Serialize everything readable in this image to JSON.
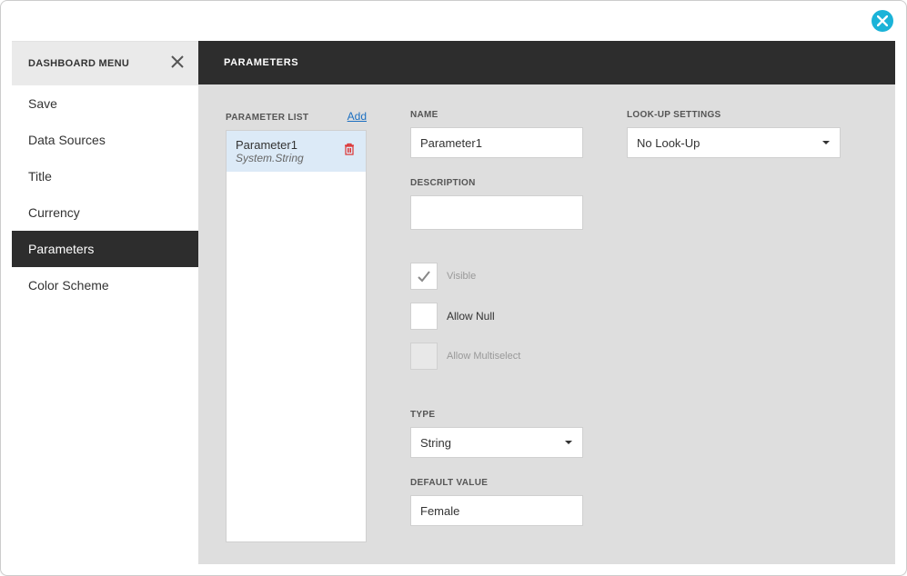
{
  "sidebar": {
    "title": "DASHBOARD MENU",
    "items": [
      {
        "label": "Save",
        "active": false
      },
      {
        "label": "Data Sources",
        "active": false
      },
      {
        "label": "Title",
        "active": false
      },
      {
        "label": "Currency",
        "active": false
      },
      {
        "label": "Parameters",
        "active": true
      },
      {
        "label": "Color Scheme",
        "active": false
      }
    ]
  },
  "header": {
    "title": "PARAMETERS"
  },
  "paramList": {
    "label": "PARAMETER LIST",
    "addLabel": "Add",
    "items": [
      {
        "name": "Parameter1",
        "type": "System.String"
      }
    ]
  },
  "form": {
    "nameLabel": "NAME",
    "nameValue": "Parameter1",
    "descLabel": "DESCRIPTION",
    "descValue": "",
    "visibleLabel": "Visible",
    "allowNullLabel": "Allow Null",
    "allowMultiLabel": "Allow Multiselect",
    "typeLabel": "TYPE",
    "typeValue": "String",
    "defaultLabel": "DEFAULT VALUE",
    "defaultValue": "Female"
  },
  "lookup": {
    "label": "LOOK-UP SETTINGS",
    "value": "No Look-Up"
  }
}
